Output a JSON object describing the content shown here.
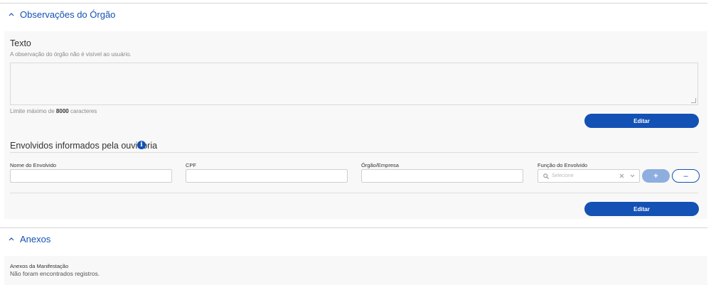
{
  "section_observacoes": {
    "title": "Observações do Órgão"
  },
  "texto": {
    "label": "Texto",
    "hint": "A observação do órgão não é visível ao usuário.",
    "value": "",
    "limit_prefix": "Limite máximo de ",
    "limit_value": "8000",
    "limit_suffix": " caracteres",
    "edit_button": "Editar"
  },
  "envolvidos": {
    "title": "Envolvidos informados pela ouvidoria",
    "columns": {
      "nome": "Nome do Envolvido",
      "cpf": "CPF",
      "orgao": "Órgão/Empresa",
      "funcao": "Função do Envolvido"
    },
    "values": {
      "nome": "",
      "cpf": "",
      "orgao": ""
    },
    "select_placeholder": "Selecione",
    "add_glyph": "+",
    "remove_glyph": "–",
    "edit_button": "Editar"
  },
  "section_anexos": {
    "title": "Anexos"
  },
  "anexos": {
    "label": "Anexos da Manifestação",
    "empty": "Não foram encontrados registros."
  },
  "colors": {
    "accent": "#1351b4",
    "panel": "#f8f8f8"
  },
  "icons": {
    "chevron": "chevron-up-icon",
    "info": "info-icon",
    "search": "search-icon",
    "clear": "close-icon",
    "dropdown": "chevron-down-icon"
  }
}
